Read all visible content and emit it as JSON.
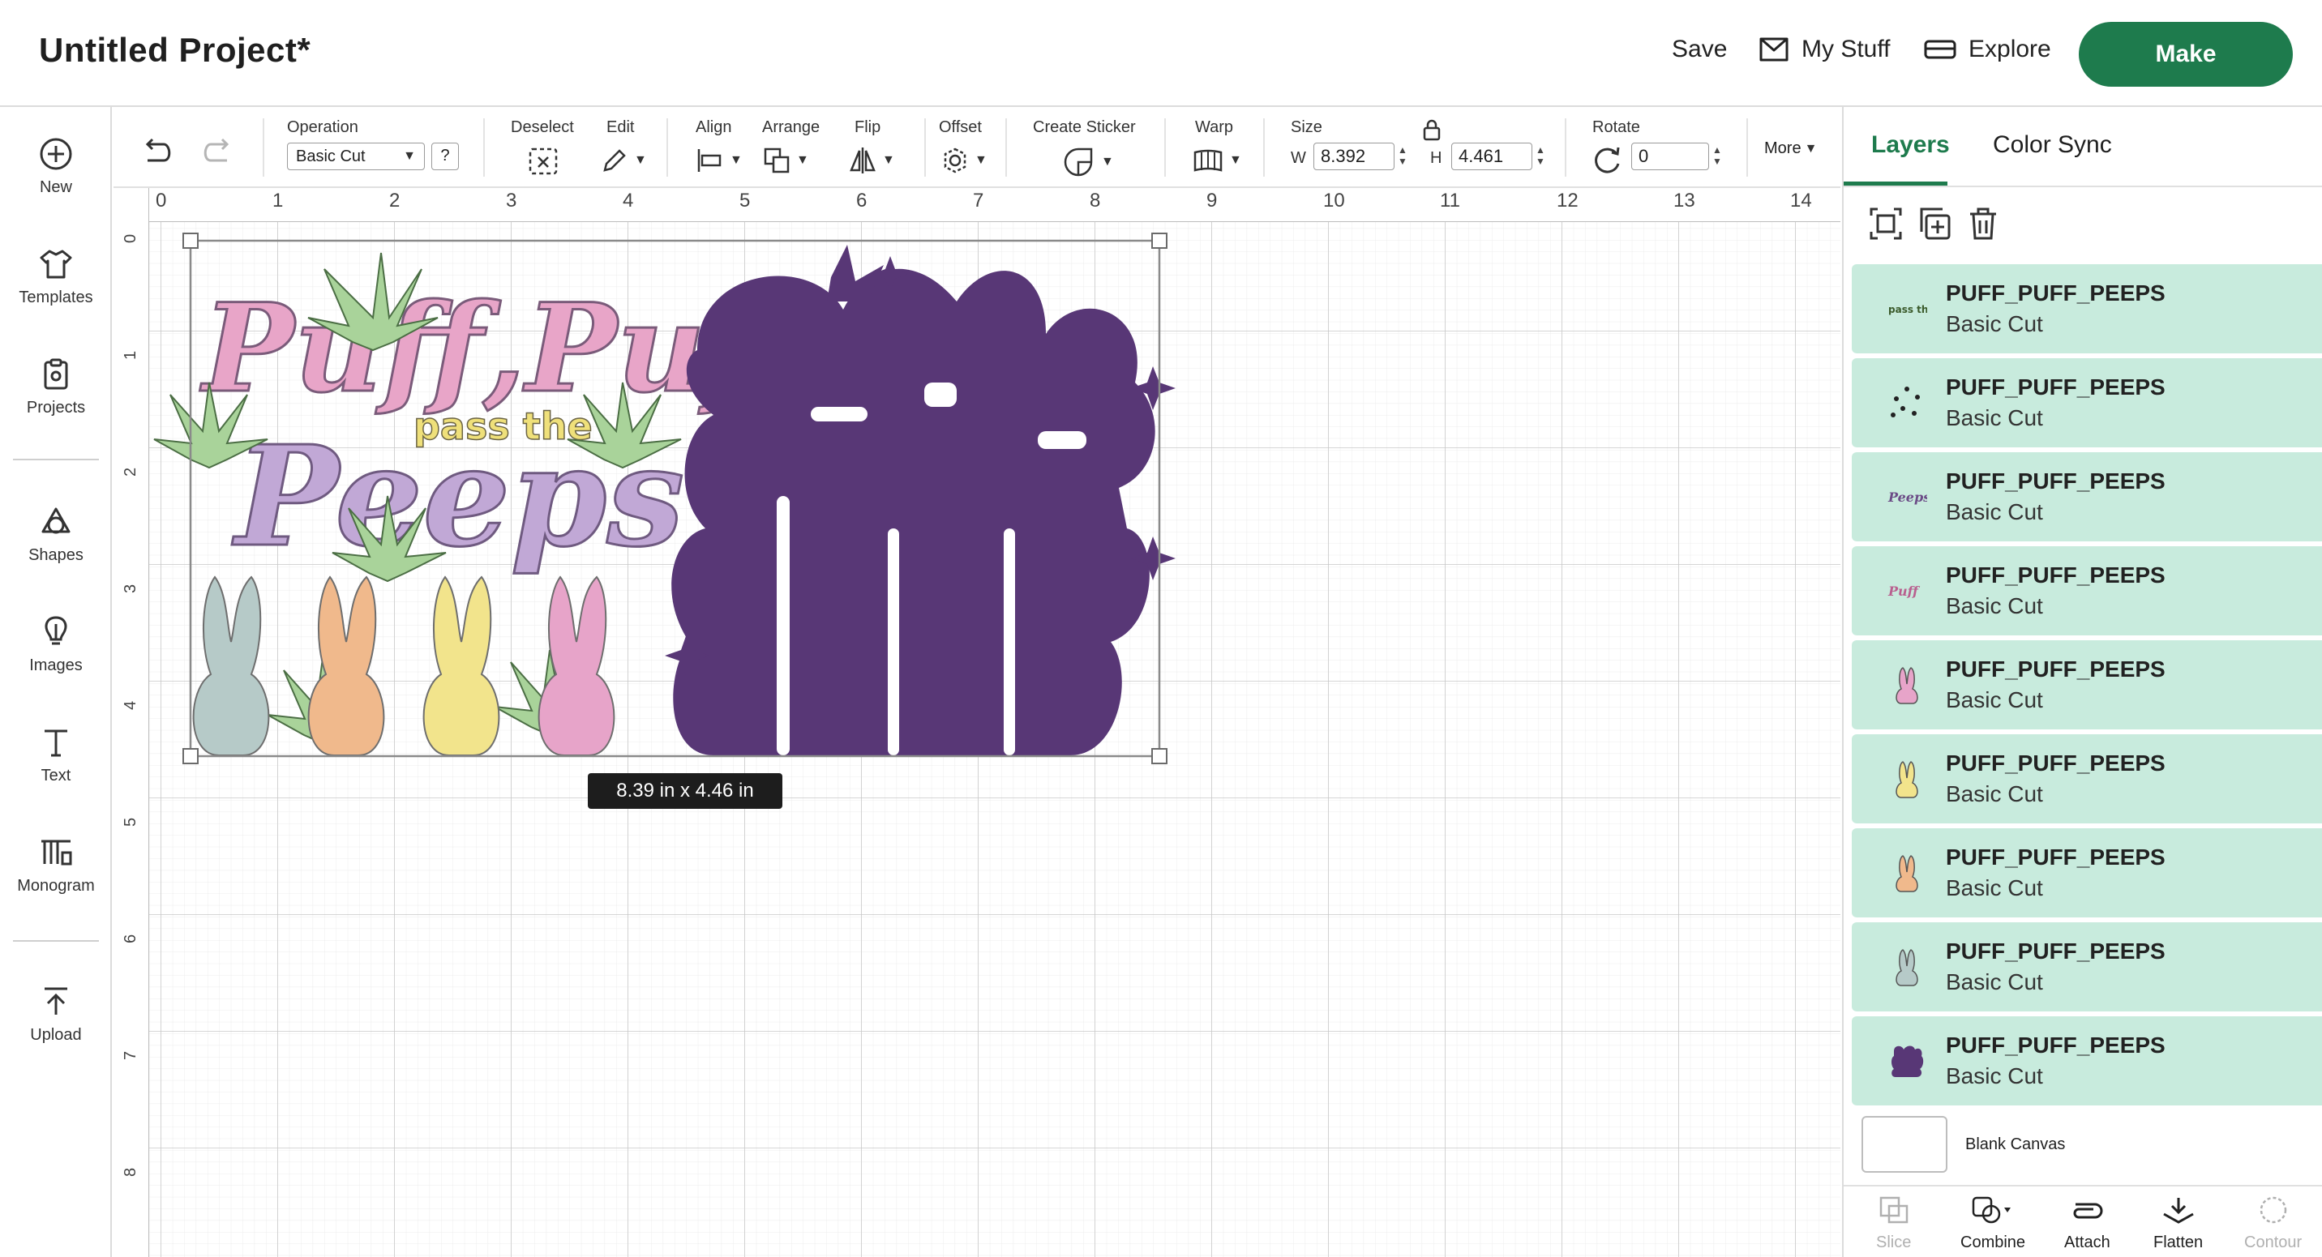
{
  "header": {
    "title": "Untitled Project*",
    "save": "Save",
    "my_stuff": "My Stuff",
    "explore": "Explore",
    "make": "Make"
  },
  "sidebar": {
    "items": [
      {
        "label": "New",
        "icon": "plus-circle-icon"
      },
      {
        "label": "Templates",
        "icon": "shirt-icon"
      },
      {
        "label": "Projects",
        "icon": "clipboard-icon"
      },
      {
        "label": "Shapes",
        "icon": "shapes-icon"
      },
      {
        "label": "Images",
        "icon": "lightbulb-icon"
      },
      {
        "label": "Text",
        "icon": "text-icon"
      },
      {
        "label": "Monogram",
        "icon": "monogram-icon"
      },
      {
        "label": "Upload",
        "icon": "upload-icon"
      }
    ]
  },
  "toolbar": {
    "operation_label": "Operation",
    "operation_value": "Basic Cut",
    "help": "?",
    "deselect": "Deselect",
    "edit": "Edit",
    "align": "Align",
    "arrange": "Arrange",
    "flip": "Flip",
    "offset": "Offset",
    "create_sticker": "Create Sticker",
    "warp": "Warp",
    "size": "Size",
    "w_label": "W",
    "w_value": "8.392",
    "h_label": "H",
    "h_value": "4.461",
    "rotate": "Rotate",
    "rotate_value": "0",
    "more": "More"
  },
  "canvas": {
    "ruler_top": [
      "0",
      "1",
      "2",
      "3",
      "4",
      "5",
      "6",
      "7",
      "8",
      "9",
      "10",
      "11",
      "12",
      "13",
      "14"
    ],
    "ruler_left": [
      "0",
      "1",
      "2",
      "3",
      "4",
      "5",
      "6",
      "7",
      "8"
    ],
    "size_tooltip": "8.39  in x 4.46  in",
    "artwork_text_1": "Puff,Puff",
    "artwork_text_2": "pass the",
    "artwork_text_3": "Peeps",
    "colors": {
      "pink": "#e8a5c8",
      "lavender": "#c1a8d6",
      "purple": "#583776",
      "leaf": "#a9d39a",
      "peep_blue": "#b6cac8",
      "peep_orange": "#f0b98c",
      "peep_yellow": "#f2e48c",
      "peep_pink": "#e7a4c9"
    }
  },
  "panel": {
    "tabs": [
      "Layers",
      "Color Sync"
    ],
    "layers": [
      {
        "name": "PUFF_PUFF_PEEPS",
        "op": "Basic Cut",
        "thumb": "text-thumb"
      },
      {
        "name": "PUFF_PUFF_PEEPS",
        "op": "Basic Cut",
        "thumb": "dots-thumb"
      },
      {
        "name": "PUFF_PUFF_PEEPS",
        "op": "Basic Cut",
        "thumb": "purple-script-thumb"
      },
      {
        "name": "PUFF_PUFF_PEEPS",
        "op": "Basic Cut",
        "thumb": "pink-script-thumb"
      },
      {
        "name": "PUFF_PUFF_PEEPS",
        "op": "Basic Cut",
        "thumb": "pink-bunny-thumb"
      },
      {
        "name": "PUFF_PUFF_PEEPS",
        "op": "Basic Cut",
        "thumb": "yellow-bunny-thumb"
      },
      {
        "name": "PUFF_PUFF_PEEPS",
        "op": "Basic Cut",
        "thumb": "orange-bunny-thumb"
      },
      {
        "name": "PUFF_PUFF_PEEPS",
        "op": "Basic Cut",
        "thumb": "blue-bunny-thumb"
      },
      {
        "name": "PUFF_PUFF_PEEPS",
        "op": "Basic Cut",
        "thumb": "purple-silhouette-thumb"
      }
    ],
    "blank_canvas": "Blank Canvas",
    "bottom_tools": [
      {
        "label": "Slice",
        "enabled": false
      },
      {
        "label": "Combine",
        "enabled": true
      },
      {
        "label": "Attach",
        "enabled": true
      },
      {
        "label": "Flatten",
        "enabled": true
      },
      {
        "label": "Contour",
        "enabled": false
      }
    ]
  }
}
